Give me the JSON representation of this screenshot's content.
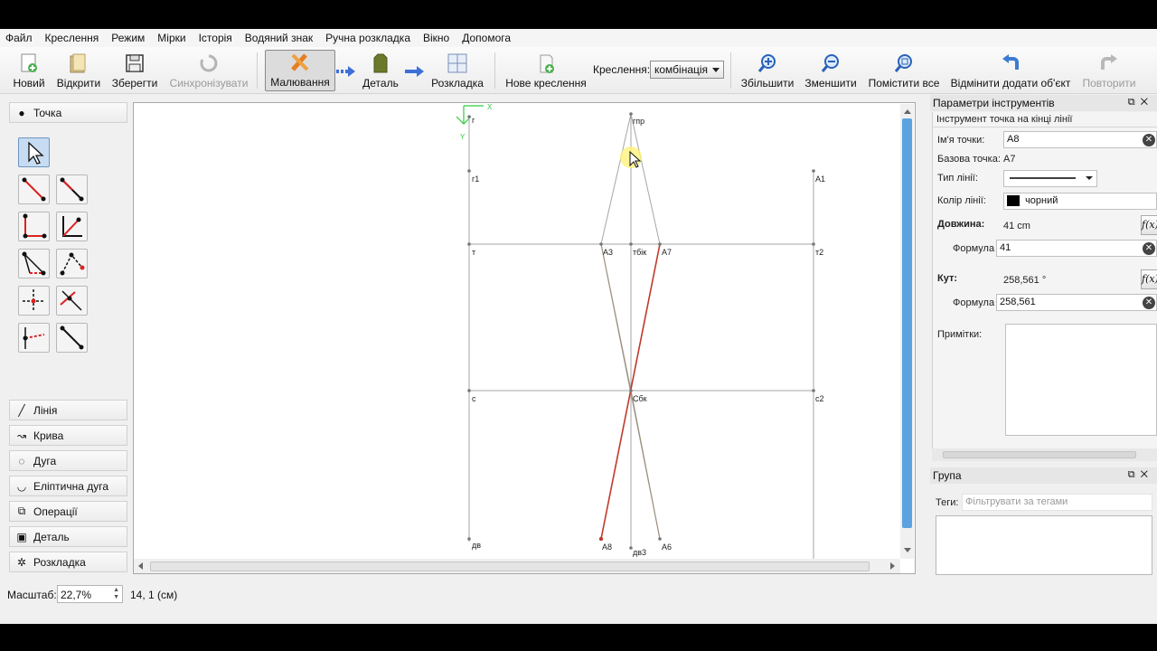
{
  "menu": [
    "Файл",
    "Креслення",
    "Режим",
    "Мірки",
    "Історія",
    "Водяний знак",
    "Ручна розкладка",
    "Вікно",
    "Допомога"
  ],
  "toolbar": {
    "new_label": "Новий",
    "open_label": "Відкрити",
    "save_label": "Зберегти",
    "sync_label": "Синхронізувати",
    "draw_mode_label": "Малювання",
    "detail_mode_label": "Деталь",
    "layout_mode_label": "Розкладка",
    "new_drawing_label": "Нове креслення",
    "drawing_select_label": "Креслення:",
    "drawing_select_value": "комбінація",
    "zoom_in_label": "Збільшити",
    "zoom_out_label": "Зменшити",
    "fit_all_label": "Помістити все",
    "undo_label": "Відмінити додати об'єкт",
    "redo_label": "Повторити"
  },
  "left_panel": {
    "point_group": "Точка",
    "groups": [
      "Лінія",
      "Крива",
      "Дуга",
      "Еліптична дуга",
      "Операції",
      "Деталь",
      "Розкладка"
    ]
  },
  "canvas": {
    "axis_x": "X",
    "axis_y": "Y",
    "point_labels": [
      "г",
      "гпр",
      "г1",
      "A1",
      "т",
      "A3",
      "тбік",
      "A7",
      "т2",
      "с",
      "Сбк",
      "с2",
      "дв",
      "A8",
      "дв3",
      "A6"
    ]
  },
  "props": {
    "panel_title": "Параметри інструментів",
    "tool_title": "Інструмент точка на кінці лінії",
    "point_name_label": "Ім'я точки:",
    "point_name_value": "A8",
    "base_point_label": "Базова точка:",
    "base_point_value": "A7",
    "line_type_label": "Тип лінії:",
    "line_color_label": "Колір лінії:",
    "line_color_value": "чорний",
    "length_label": "Довжина:",
    "length_value": "41 cm",
    "formula_label": "Формула",
    "length_formula": "41",
    "angle_label": "Кут:",
    "angle_value": "258,561 °",
    "angle_formula": "258,561",
    "notes_label": "Примітки:",
    "fx_label": "f(x)"
  },
  "group_panel": {
    "title": "Група",
    "tags_label": "Теги:",
    "tags_placeholder": "Фільтрувати за тегами"
  },
  "status": {
    "scale_label": "Масштаб:",
    "scale_value": "22,7%",
    "coords": "14, 1 (см)"
  },
  "colors": {
    "accent": "#5aa3e0",
    "selected_line": "#c0392b",
    "line": "#9a9a9a"
  }
}
